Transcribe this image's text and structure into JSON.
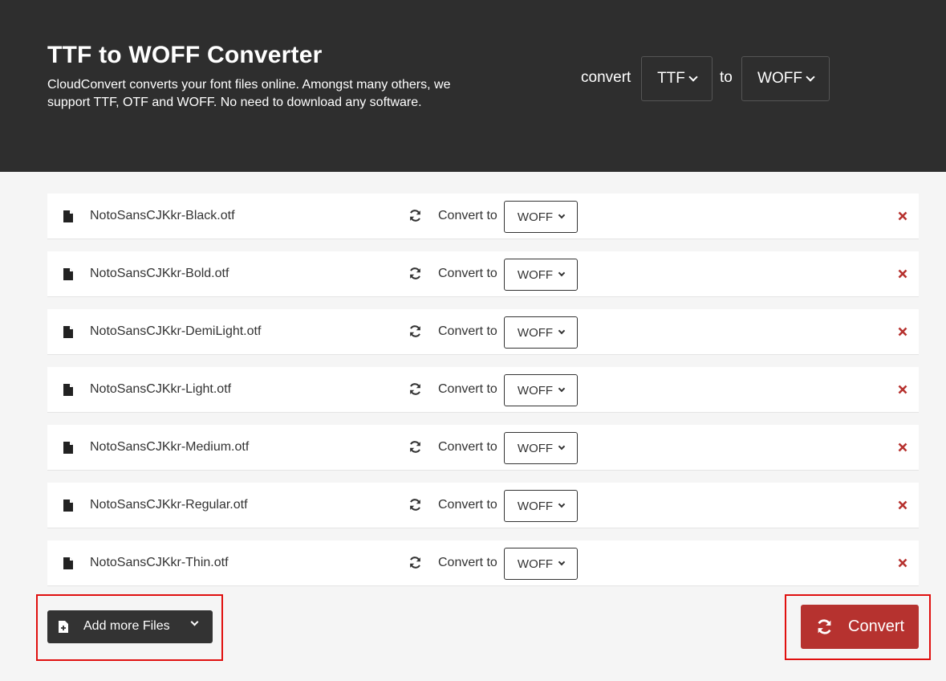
{
  "header": {
    "title": "TTF to WOFF Converter",
    "description": "CloudConvert converts your font files online. Amongst many others, we support TTF, OTF and WOFF. No need to download any software.",
    "convert_word": "convert",
    "from_format": "TTF",
    "to_word": "to",
    "to_format": "WOFF"
  },
  "files": [
    {
      "name": "NotoSansCJKkr-Black.otf",
      "convert_label": "Convert to",
      "format": "WOFF"
    },
    {
      "name": "NotoSansCJKkr-Bold.otf",
      "convert_label": "Convert to",
      "format": "WOFF"
    },
    {
      "name": "NotoSansCJKkr-DemiLight.otf",
      "convert_label": "Convert to",
      "format": "WOFF"
    },
    {
      "name": "NotoSansCJKkr-Light.otf",
      "convert_label": "Convert to",
      "format": "WOFF"
    },
    {
      "name": "NotoSansCJKkr-Medium.otf",
      "convert_label": "Convert to",
      "format": "WOFF"
    },
    {
      "name": "NotoSansCJKkr-Regular.otf",
      "convert_label": "Convert to",
      "format": "WOFF"
    },
    {
      "name": "NotoSansCJKkr-Thin.otf",
      "convert_label": "Convert to",
      "format": "WOFF"
    }
  ],
  "actions": {
    "add_more_label": "Add more Files",
    "convert_label": "Convert"
  },
  "colors": {
    "header_bg": "#2e2e2e",
    "accent": "#b6322f",
    "highlight": "#e0100f"
  },
  "icons": {
    "file": "file-icon",
    "refresh": "refresh-icon",
    "remove": "close-icon",
    "add_file": "file-plus-icon",
    "chevron": "chevron-down-icon"
  }
}
